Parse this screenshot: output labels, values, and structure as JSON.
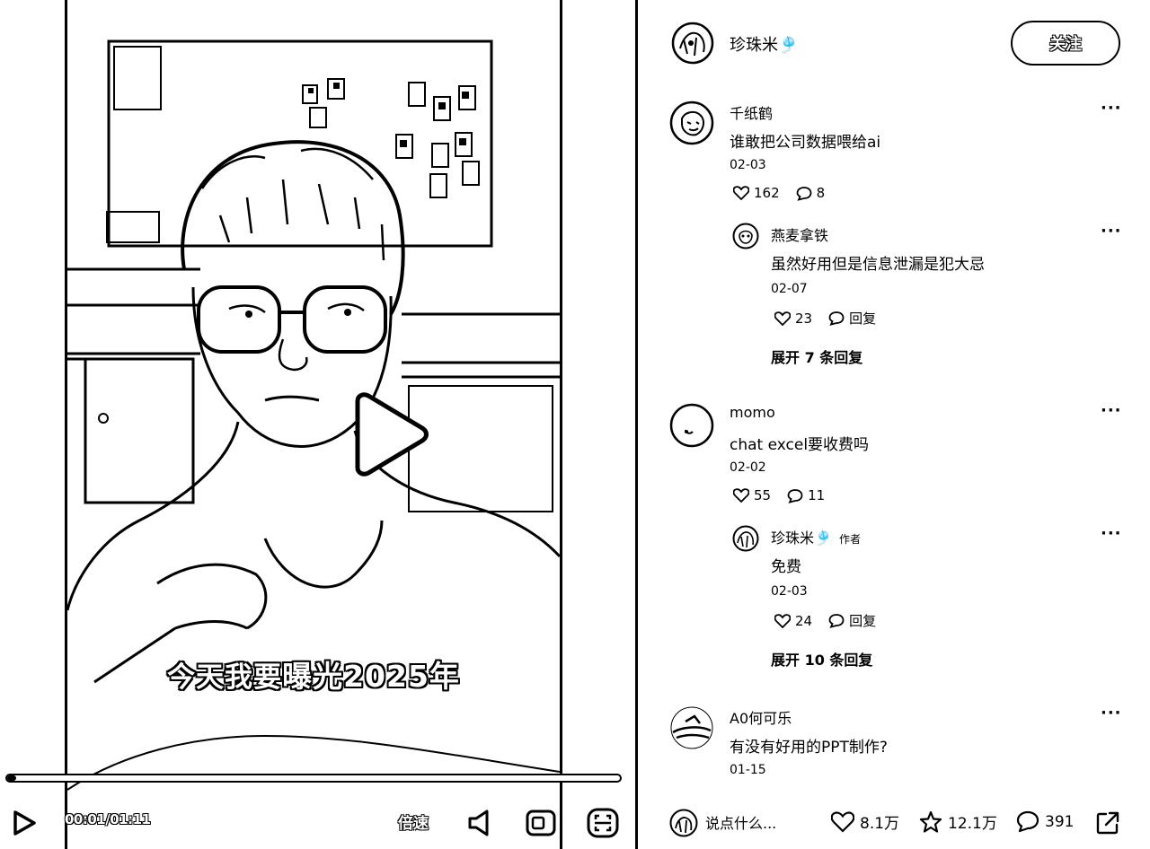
{
  "video": {
    "subtitle_pre": "今天我要",
    "subtitle_strong": "曝光2025年",
    "progress_fraction": 0.0141,
    "time": "00:01/01:11",
    "speed_label": "倍速"
  },
  "author": {
    "name": "珍珠米🎐",
    "follow_label": "关注"
  },
  "comments": [
    {
      "user": "千纸鹤",
      "text": "谁敢把公司数据喂给ai",
      "date": "02-03",
      "likes": "162",
      "replies": "8",
      "reply": {
        "user": "燕麦拿铁",
        "text": "虽然好用但是信息泄漏是犯大忌",
        "date": "02-07",
        "likes": "23",
        "reply_label": "回复"
      },
      "expand_label": "展开 7 条回复"
    },
    {
      "user": "momo",
      "text": "chat excel要收费吗",
      "date": "02-02",
      "likes": "55",
      "replies": "11",
      "reply": {
        "user": "珍珠米🎐",
        "author_tag": "作者",
        "text": "免费",
        "date": "02-03",
        "likes": "24",
        "reply_label": "回复"
      },
      "expand_label": "展开 10 条回复"
    },
    {
      "user": "A0何可乐",
      "text": "有没有好用的PPT制作?",
      "date": "01-15"
    }
  ],
  "bottom_bar": {
    "input_placeholder": "说点什么...",
    "likes": "8.1万",
    "favorites": "12.1万",
    "comments": "391"
  }
}
